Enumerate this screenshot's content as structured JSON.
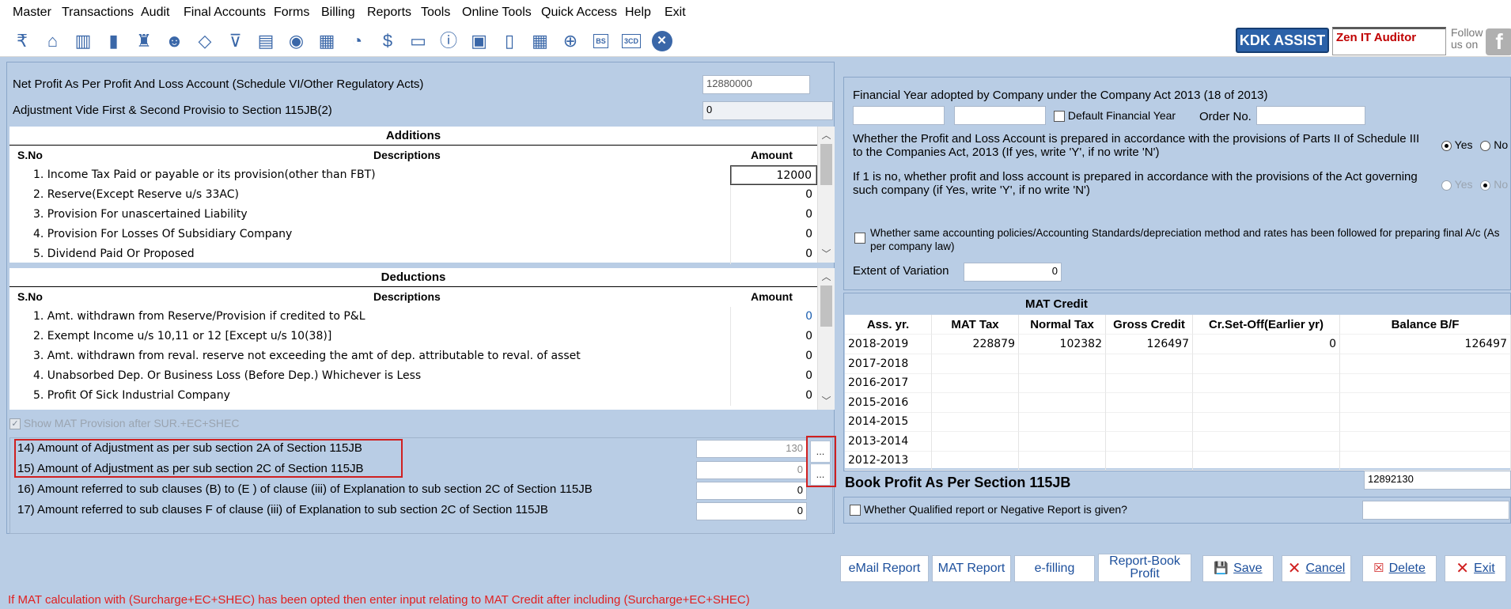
{
  "menu": [
    {
      "label": "Master"
    },
    {
      "label": "Transactions"
    },
    {
      "label": "Audit"
    },
    {
      "label": "Final Accounts"
    },
    {
      "label": "Forms"
    },
    {
      "label": "Billing"
    },
    {
      "label": "Reports"
    },
    {
      "label": "Tools"
    },
    {
      "label": "Online Tools"
    },
    {
      "label": "Quick Access"
    },
    {
      "label": "Help"
    },
    {
      "label": "Exit"
    }
  ],
  "toolbar": {
    "icons": [
      "rupee-icon",
      "home-icon",
      "building-icon",
      "bar-chart-icon",
      "gift-icon",
      "users-icon",
      "tag-icon",
      "filter-icon",
      "tax-icon",
      "broadcast-icon",
      "calculator-icon",
      "pie-icon",
      "pay-icon",
      "book-icon",
      "info-icon",
      "form-icon",
      "document-icon",
      "calendar-icon",
      "file-add-icon",
      "bs-icon",
      "3cd-icon",
      "close-icon"
    ],
    "kdk_assist": "KDK ASSIST",
    "zen_label": "Zen IT Auditor",
    "follow_text": "Follow us on",
    "facebook": "f"
  },
  "left": {
    "net_profit_label": "Net Profit As Per Profit And Loss Account (Schedule VI/Other Regulatory Acts)",
    "net_profit_value": "12880000",
    "adjustment_label": "Adjustment Vide First & Second Provisio to Section 115JB(2)",
    "adjustment_value": "0",
    "additions": {
      "title": "Additions",
      "col_sno": "S.No",
      "col_desc": "Descriptions",
      "col_amt": "Amount",
      "rows": [
        {
          "desc": "1. Income Tax Paid or payable or its provision(other than FBT)",
          "amt": "12000"
        },
        {
          "desc": "2. Reserve(Except Reserve u/s 33AC)",
          "amt": "0"
        },
        {
          "desc": "3. Provision For unascertained Liability",
          "amt": "0"
        },
        {
          "desc": "4. Provision For Losses Of Subsidiary Company",
          "amt": "0"
        },
        {
          "desc": "5. Dividend Paid Or Proposed",
          "amt": "0"
        }
      ]
    },
    "deductions": {
      "title": "Deductions",
      "col_sno": "S.No",
      "col_desc": "Descriptions",
      "col_amt": "Amount",
      "rows": [
        {
          "desc": "1. Amt. withdrawn from Reserve/Provision if credited to P&L",
          "amt": "0"
        },
        {
          "desc": "2. Exempt Income u/s 10,11 or 12 [Except u/s 10(38)]",
          "amt": "0"
        },
        {
          "desc": "3. Amt. withdrawn from reval. reserve not exceeding the amt of dep. attributable to reval. of asset",
          "amt": "0"
        },
        {
          "desc": "4. Unabsorbed Dep. Or Business Loss (Before Dep.) Whichever is Less",
          "amt": "0"
        },
        {
          "desc": "5. Profit Of Sick Industrial Company",
          "amt": "0"
        }
      ]
    },
    "show_mat_label": "Show MAT Provision after SUR.+EC+SHEC",
    "items": [
      {
        "label": "14)  Amount of Adjustment as per sub section 2A of Section 115JB",
        "value": "130"
      },
      {
        "label": "15) Amount of Adjustment as per sub section 2C of Section 115JB",
        "value": "0"
      },
      {
        "label": "16) Amount referred to sub clauses (B) to (E ) of clause (iii) of Explanation to sub section 2C of Section 115JB",
        "value": "0"
      },
      {
        "label": "17) Amount referred to sub clauses F of clause (iii) of Explanation to sub section 2C of Section 115JB",
        "value": "0"
      }
    ],
    "ellipsis": "..."
  },
  "right": {
    "fy_label": "Financial Year adopted by Company under the Company Act 2013 (18 of 2013)",
    "default_fy_label": "Default Financial Year",
    "order_no_label": "Order No.",
    "q1": "Whether the Profit and Loss Account is prepared in accordance with the provisions of Parts II of Schedule III to the Companies Act, 2013 (If yes, write 'Y', if no write 'N')",
    "q1_yes": "Yes",
    "q1_no": "No",
    "q2": "If 1 is no, whether profit and loss account is prepared in accordance with the provisions of the Act governing such company (if Yes, write 'Y', if no write 'N')",
    "q2_yes": "Yes",
    "q2_no": "No",
    "q3": "Whether same accounting policies/Accounting Standards/depreciation method and  rates has been followed for preparing final A/c (As per company law)",
    "variation_label": "Extent of Variation",
    "variation_value": "0",
    "mat_credit": {
      "title": "MAT Credit",
      "columns": [
        "Ass. yr.",
        "MAT Tax",
        "Normal Tax",
        "Gross Credit",
        "Cr.Set-Off(Earlier yr)",
        "Balance B/F"
      ],
      "rows": [
        [
          "2018-2019",
          "228879",
          "102382",
          "126497",
          "0",
          "126497"
        ],
        [
          "2017-2018",
          "",
          "",
          "",
          "",
          ""
        ],
        [
          "2016-2017",
          "",
          "",
          "",
          "",
          ""
        ],
        [
          "2015-2016",
          "",
          "",
          "",
          "",
          ""
        ],
        [
          "2014-2015",
          "",
          "",
          "",
          "",
          ""
        ],
        [
          "2013-2014",
          "",
          "",
          "",
          "",
          ""
        ],
        [
          "2012-2013",
          "",
          "",
          "",
          "",
          ""
        ]
      ]
    },
    "book_profit_label": "Book Profit As Per Section 115JB",
    "book_profit_value": "12892130",
    "qualified_label": "Whether Qualified report or Negative Report is given?"
  },
  "buttons": {
    "email": "eMail Report",
    "mat": "MAT Report",
    "efilling": "e-filling",
    "report_book": "Report-Book Profit",
    "save": "Save",
    "cancel": "Cancel",
    "delete": "Delete",
    "exit": "Exit"
  },
  "footer_note": "If MAT calculation with (Surcharge+EC+SHEC) has been opted then enter input relating to MAT Credit after including (Surcharge+EC+SHEC)",
  "colors": {
    "background": "#b9cde5",
    "accent": "#2b61a8",
    "warning": "#e02020"
  }
}
